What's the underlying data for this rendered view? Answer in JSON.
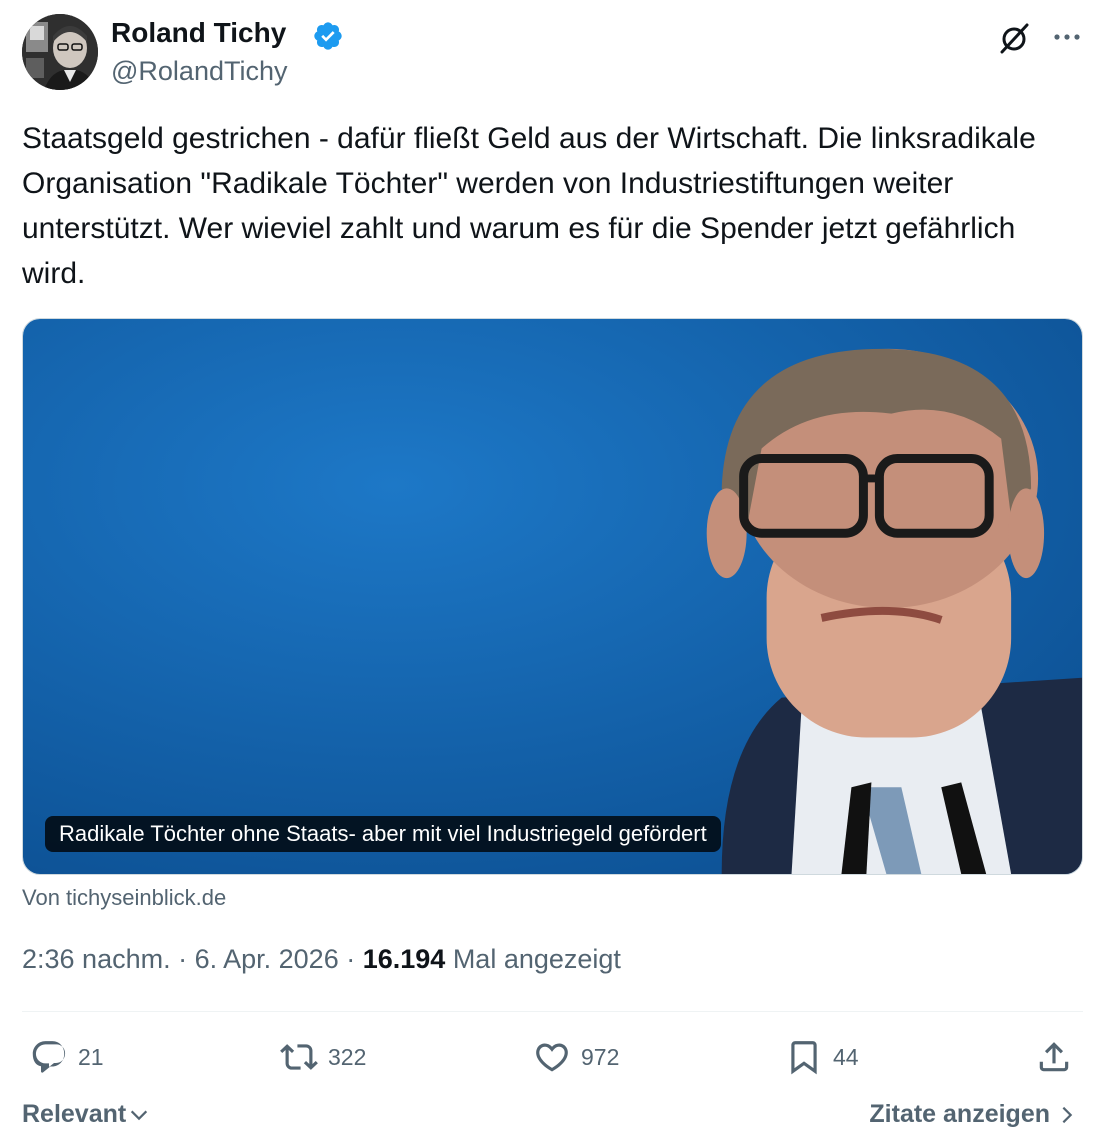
{
  "author": {
    "name": "Roland Tichy",
    "handle": "@RolandTichy"
  },
  "tweet": {
    "text": "Staatsgeld gestrichen - dafür fließt Geld aus der Wirtschaft. Die linksradikale Organisation \"Radikale Töchter\" werden von Industriestiftungen weiter unterstützt. Wer wieviel zahlt und warum es für die Spender jetzt gefährlich wird."
  },
  "card": {
    "title": "Radikale Töchter ohne Staats- aber mit viel Industriegeld gefördert",
    "source": "Von tichyseinblick.de"
  },
  "meta": {
    "time": "2:36 nachm.",
    "separator": " · ",
    "date": "6. Apr. 2026",
    "views_count": "16.194",
    "views_label": " Mal angezeigt"
  },
  "actions": {
    "replies": "21",
    "reposts": "322",
    "likes": "972",
    "bookmarks": "44"
  },
  "footer": {
    "sort_label": "Relevant",
    "quotes_label": "Zitate anzeigen"
  },
  "colors": {
    "text_primary": "#0f1419",
    "text_secondary": "#536471",
    "verified_blue": "#1d9bf0",
    "card_background": "#1c6cb8"
  },
  "icons": [
    "verified-badge-icon",
    "grok-icon",
    "more-icon",
    "reply-icon",
    "repost-icon",
    "like-icon",
    "bookmark-icon",
    "share-icon",
    "chevron-down-icon",
    "chevron-right-icon"
  ]
}
